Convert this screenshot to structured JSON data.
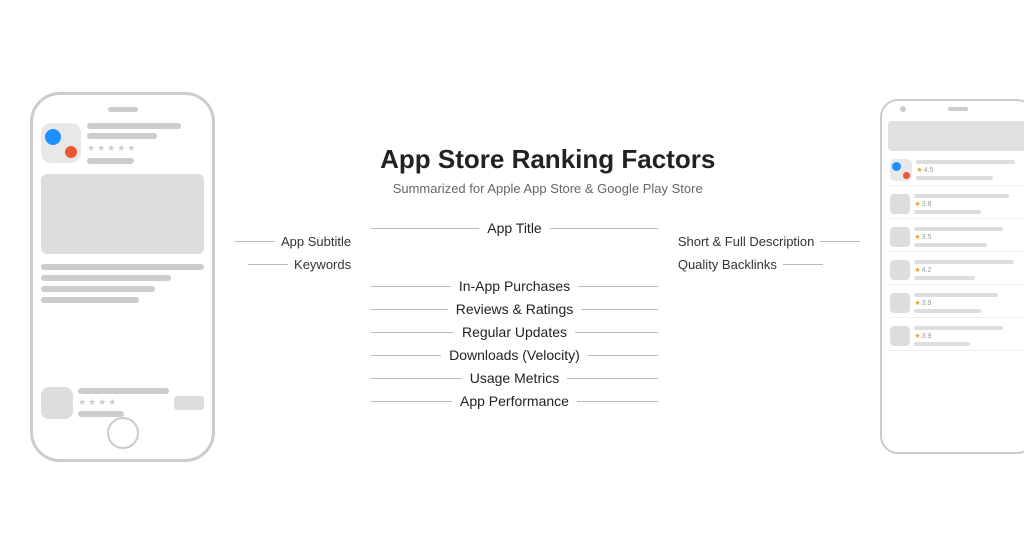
{
  "page": {
    "bg": "#ffffff"
  },
  "header": {
    "title": "App Store Ranking Factors",
    "subtitle": "Summarized for Apple App Store & Google Play Store"
  },
  "factors": {
    "top_center": "App Title",
    "left": [
      {
        "label": "App Subtitle"
      },
      {
        "label": "Keywords"
      }
    ],
    "right": [
      {
        "label": "Short & Full Description"
      },
      {
        "label": "Quality Backlinks"
      }
    ],
    "center": [
      {
        "label": "In-App Purchases"
      },
      {
        "label": "Reviews & Ratings"
      },
      {
        "label": "Regular Updates"
      },
      {
        "label": "Downloads (Velocity)"
      },
      {
        "label": "Usage Metrics"
      },
      {
        "label": "App Performance"
      }
    ]
  },
  "phone_left": {
    "aria": "iPhone mockup"
  },
  "phone_right": {
    "aria": "Android mockup",
    "reviews": [
      {
        "rating": "4.5"
      },
      {
        "rating": "3.8"
      },
      {
        "rating": "3.5"
      },
      {
        "rating": "4.2"
      },
      {
        "rating": "3.9"
      },
      {
        "rating": "3.9"
      }
    ]
  }
}
